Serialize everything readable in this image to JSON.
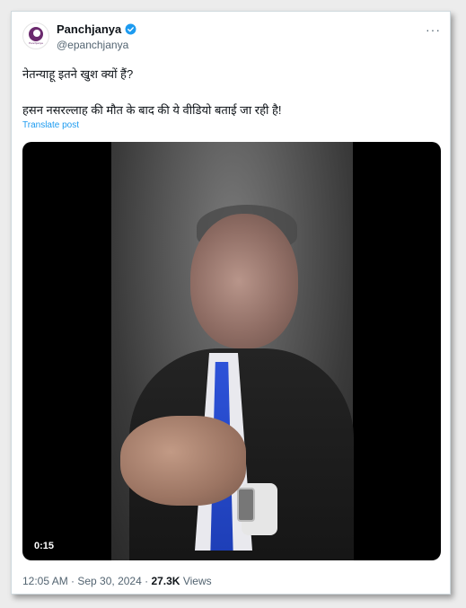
{
  "author": {
    "display_name": "Panchjanya",
    "handle": "@epanchjanya",
    "avatar_text": "Panchjanya",
    "verified": true
  },
  "more_label": "···",
  "tweet": {
    "line1": "नेतन्याहू इतने खुश क्यों हैं?",
    "line2": "हसन नसरल्लाह की मौत के बाद की ये वीडियो बताई जा रही है!",
    "translate_label": "Translate post"
  },
  "video": {
    "duration": "0:15"
  },
  "meta": {
    "time": "12:05 AM",
    "separator": " · ",
    "date": "Sep 30, 2024",
    "views_count": "27.3K",
    "views_label": " Views"
  },
  "colors": {
    "link": "#1d9bf0",
    "verified": "#1d9bf0",
    "text": "#0f1419",
    "muted": "#536471"
  },
  "icons": [
    "verified-badge-icon",
    "more-options-icon"
  ]
}
